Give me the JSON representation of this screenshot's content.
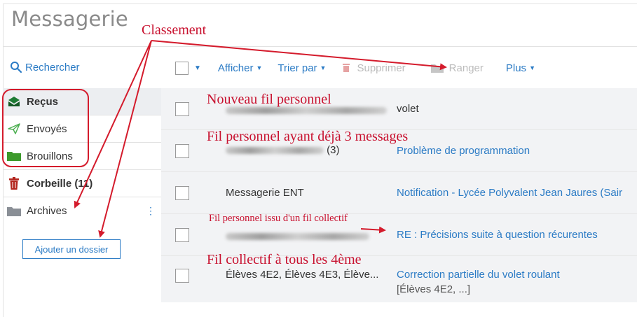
{
  "app": {
    "title": "Messagerie"
  },
  "search": {
    "label": "Rechercher",
    "icon": "search-icon"
  },
  "toolbar": {
    "afficher": "Afficher",
    "trier": "Trier par",
    "supprimer": "Supprimer",
    "ranger": "Ranger",
    "plus": "Plus"
  },
  "sidebar": {
    "items": [
      {
        "label": "Reçus",
        "icon": "inbox-icon"
      },
      {
        "label": "Envoyés",
        "icon": "send-icon"
      },
      {
        "label": "Brouillons",
        "icon": "folder-icon"
      },
      {
        "label": "Corbeille (11)",
        "icon": "trash-icon"
      },
      {
        "label": "Archives",
        "icon": "folder-icon"
      }
    ],
    "add_folder": "Ajouter un dossier"
  },
  "messages": [
    {
      "from": "",
      "subject": "volet"
    },
    {
      "from": "(3)",
      "subject": "Problème de programmation"
    },
    {
      "from": "Messagerie ENT",
      "subject": "Notification - Lycée Polyvalent Jean Jaures (Sair"
    },
    {
      "from": "",
      "subject": "RE : Précisions suite à question récurentes"
    },
    {
      "from": "Élèves 4E2, Élèves 4E3, Élève...",
      "subject": "Correction partielle du volet roulant",
      "subject2": "[Élèves 4E2, ...]"
    }
  ],
  "annotations": {
    "classement": "Classement",
    "nouveau_fil": "Nouveau fil personnel",
    "fil_3": "Fil personnel ayant déjà 3 messages",
    "fil_issu": "Fil personnel issu d'un fil collectif",
    "fil_collectif": "Fil collectif à tous les 4ème"
  },
  "colors": {
    "accent": "#2b7bc5",
    "annotation": "#c8102e",
    "inbox_green": "#1e7b34",
    "trash_red": "#b3261e"
  }
}
